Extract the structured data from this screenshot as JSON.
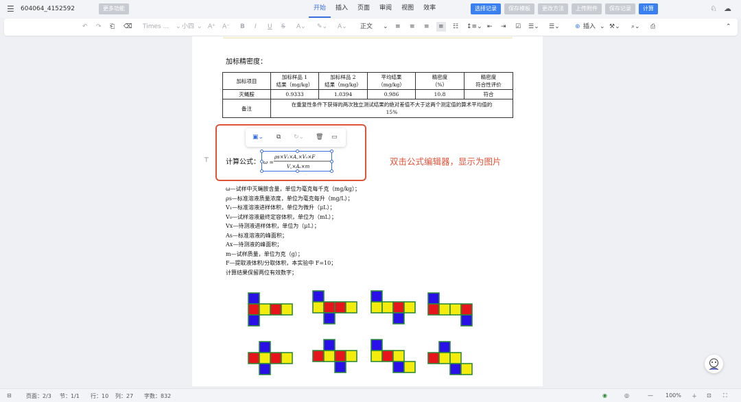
{
  "topbar": {
    "doc_title": "604064_4152592",
    "more_features": "更多功能",
    "tabs": [
      "开始",
      "插入",
      "页面",
      "审阅",
      "视图",
      "效率"
    ],
    "active_tab": "开始",
    "actions": [
      "选择记录",
      "保存模板",
      "更改方法",
      "上传附件",
      "保存记录",
      "计算"
    ]
  },
  "toolbar": {
    "font_name": "Times ...",
    "font_size": "小四",
    "style": "正文",
    "insert": "插入"
  },
  "document": {
    "section_title": "加标精密度：",
    "table": {
      "header": [
        "加标项目",
        "加标样品 1\n结果（mg/kg）",
        "加标样品 2\n结果（mg/kg）",
        "平均结果\n（mg/kg）",
        "精密度\n（%）",
        "精密度\n符合性评价"
      ],
      "rows": [
        [
          "灭蝇胺",
          "0.9333",
          "1.0394",
          "0.986",
          "10.8",
          "符合"
        ]
      ],
      "note_label": "备注",
      "note_text": "在重复性条件下获得的两次独立测试结果的绝对差值不大于这两个测定值的算术平均值的 15%"
    },
    "calc_label": "计算公式：",
    "formula": {
      "lhs": "ω =",
      "numerator": "ρs×V₁×A꜀×V₀×F",
      "denominator": "V꜀×Aₛ×m"
    },
    "annotation": "双击公式编辑器，显示为图片",
    "definitions": [
      "ω—试样中灭蝇胺含量，单位为毫克每千克（mg/kg）；",
      "ρs—标准溶液质量浓度，单位为毫克每升（mg/L）；",
      "V₁—标准溶液进样体积，单位为微升（μL）；",
      "V₀—试样溶液最终定容体积，单位为（mL）；",
      "Vx—待测液进样体积，单位为（μL）；",
      "As—标准溶液的峰面积；",
      "Ax—待测液的峰面积；",
      "m—试样质量，单位为克（g）；",
      "F—提取液体积/分取体积，本实验中 F=10；",
      "计算结果保留两位有效数字；"
    ]
  },
  "statusbar": {
    "page": "页面：2/3",
    "section": "节：1/1",
    "line": "行：10",
    "column": "列：27",
    "words": "字数：832",
    "zoom": "100%"
  },
  "colors": {
    "accent": "#3a80f0",
    "annotation": "#e0543a",
    "cube_blue": "#2a10e8",
    "cube_red": "#e8141c",
    "cube_yellow": "#f4ec0c",
    "cube_border": "#2c8a3a"
  }
}
